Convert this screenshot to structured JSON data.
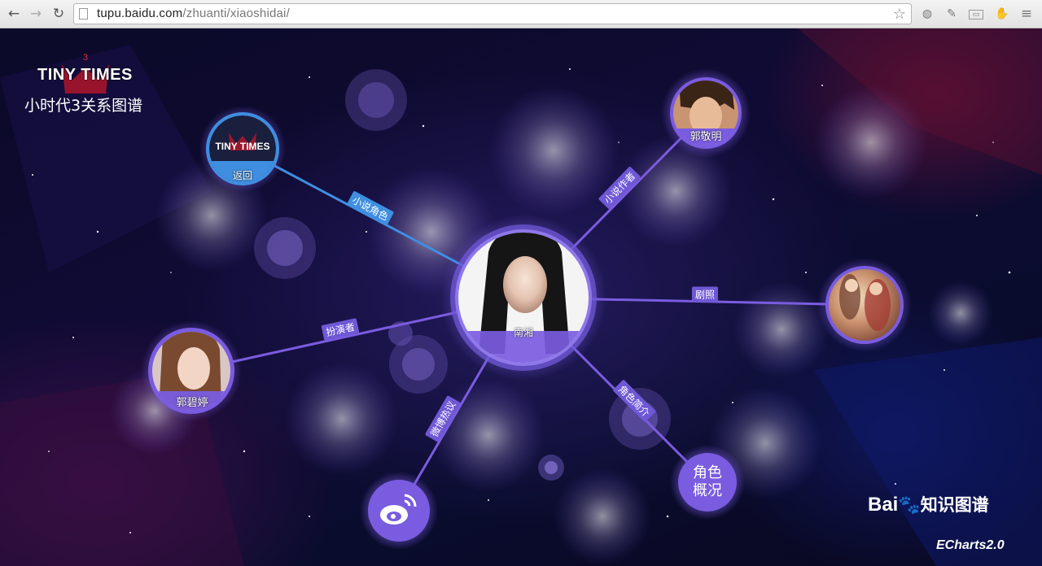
{
  "browser": {
    "url_host": "tupu.baidu.com",
    "url_path": "/zhuanti/xiaoshidai/",
    "back_icon": "back-arrow-icon",
    "forward_icon": "forward-arrow-icon",
    "reload_icon": "reload-icon"
  },
  "logo": {
    "title": "TINY TIMES",
    "superscript": "3",
    "subtitle": "小时代3关系图谱"
  },
  "graph": {
    "center": {
      "name": "南湘"
    },
    "nodes": {
      "back": {
        "logo_text": "TINY TIMES",
        "label": "返回"
      },
      "author": {
        "name": "郭敬明"
      },
      "actress": {
        "name": "郭碧婷"
      },
      "stills": {
        "icon": "photo-stills"
      },
      "weibo": {
        "icon": "weibo-icon"
      },
      "overview": {
        "line1": "角色",
        "line2": "概况"
      }
    },
    "edges": {
      "novel_role": "小说角色",
      "novel_author": "小说作者",
      "stills": "剧照",
      "actor": "扮演者",
      "weibo_talk": "微博热议",
      "role_intro": "角色简介"
    }
  },
  "footer": {
    "baidu_brand": "Bai",
    "baidu_kg": "知识图谱",
    "echarts": "ECharts2.0"
  },
  "colors": {
    "accent_purple": "#7a5ce0",
    "accent_blue": "#3f8ee0",
    "chrome_bg": "#e8e8e8"
  }
}
